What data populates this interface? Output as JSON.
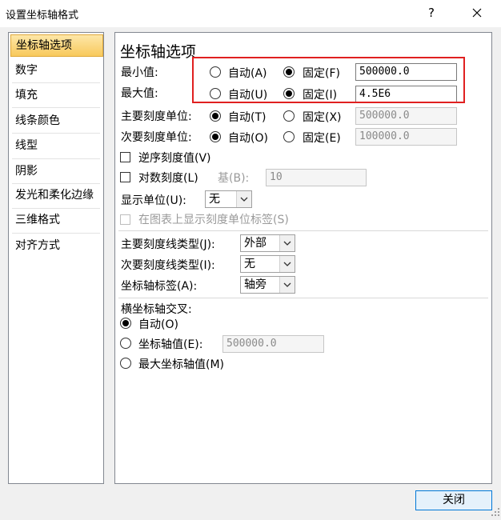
{
  "window": {
    "title": "设置坐标轴格式",
    "help_label": "?"
  },
  "nav": {
    "items": [
      {
        "label": "坐标轴选项",
        "selected": true
      },
      {
        "label": "数字"
      },
      {
        "label": "填充"
      },
      {
        "label": "线条颜色"
      },
      {
        "label": "线型"
      },
      {
        "label": "阴影"
      },
      {
        "label": "发光和柔化边缘"
      },
      {
        "label": "三维格式"
      },
      {
        "label": "对齐方式"
      }
    ]
  },
  "panel": {
    "title": "坐标轴选项",
    "min": {
      "label": "最小值:",
      "auto": "自动(A)",
      "fixed": "固定(F)",
      "value": "500000.0"
    },
    "max": {
      "label": "最大值:",
      "auto": "自动(U)",
      "fixed": "固定(I)",
      "value": "4.5E6"
    },
    "major_unit": {
      "label": "主要刻度单位:",
      "auto": "自动(T)",
      "fixed": "固定(X)",
      "value": "500000.0"
    },
    "minor_unit": {
      "label": "次要刻度单位:",
      "auto": "自动(O)",
      "fixed": "固定(E)",
      "value": "100000.0"
    },
    "reverse": {
      "label": "逆序刻度值(V)"
    },
    "log": {
      "label": "对数刻度(L)",
      "base_label": "基(B):",
      "base_value": "10"
    },
    "display_units": {
      "label": "显示单位(U):",
      "value": "无"
    },
    "show_units_label": {
      "label": "在图表上显示刻度单位标签(S)"
    },
    "major_tick": {
      "label": "主要刻度线类型(J):",
      "value": "外部"
    },
    "minor_tick": {
      "label": "次要刻度线类型(I):",
      "value": "无"
    },
    "axis_labels": {
      "label": "坐标轴标签(A):",
      "value": "轴旁"
    },
    "cross": {
      "label": "横坐标轴交叉:",
      "auto": "自动(O)",
      "axis_value_label": "坐标轴值(E):",
      "axis_value": "500000.0",
      "max_label": "最大坐标轴值(M)"
    }
  },
  "footer": {
    "close_label": "关闭"
  }
}
